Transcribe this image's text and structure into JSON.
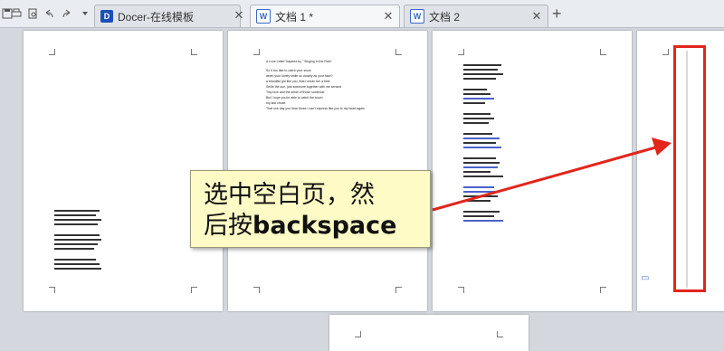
{
  "tabs": [
    {
      "label": "Docer-在线模板",
      "icon": "docer-icon",
      "active": false
    },
    {
      "label": "文档 1 *",
      "icon": "document-icon",
      "active": true
    },
    {
      "label": "文档 2",
      "icon": "document-icon",
      "active": false
    }
  ],
  "page2_lines": [
    "A Love Letter\"Inspired by \" Singing in the Rain\"",
    "So it too late to catch your snow",
    "when your lovely smile so closely as your face?",
    "a beautiful girl like you, that I mean her a time",
    "Smile the sun, just someone together with me sensed",
    "Tiny love and the smile of those someone",
    "But I hope you're able to catch the touch",
    "my last chose",
    "That one day you hear those I can't express like you to my heart again"
  ],
  "callout": {
    "line1": "选中空白页，然",
    "line2_prefix": "后按",
    "line2_key": "backspace"
  },
  "colors": {
    "highlight_red": "#e1261c",
    "callout_bg": "#fffbc6"
  }
}
